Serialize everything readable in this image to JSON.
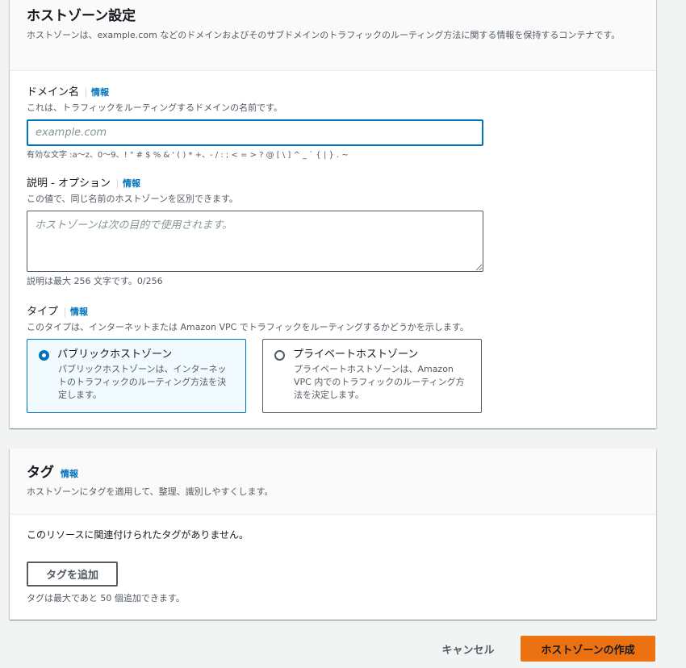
{
  "colors": {
    "accent": "#0073bb",
    "primary_button": "#ec7211",
    "page_background": "#f2f3f3",
    "selected_tile": "#f1faff"
  },
  "hosted_zone": {
    "title": "ホストゾーン設定",
    "description": "ホストゾーンは、example.com などのドメインおよびそのサブドメインのトラフィックのルーティング方法に関する情報を保持するコンテナです。"
  },
  "domain": {
    "label": "ドメイン名",
    "info": "情報",
    "description": "これは、トラフィックをルーティングするドメインの名前です。",
    "value": "",
    "placeholder": "example.com",
    "constraint": "有効な文字 :a〜z、0〜9、! \" # $ % & ' ( ) * +、- / : ; < = > ? @ [ \\ ] ^ _ ` { | } . ~"
  },
  "comment": {
    "label": "説明 - オプション",
    "info": "情報",
    "description": "この値で、同じ名前のホストゾーンを区別できます。",
    "value": "",
    "placeholder": "ホストゾーンは次の目的で使用されます。",
    "constraint": "説明は最大 256 文字です。0/256"
  },
  "type": {
    "label": "タイプ",
    "info": "情報",
    "description": "このタイプは、インターネットまたは Amazon VPC でトラフィックをルーティングするかどうかを示します。",
    "options": [
      {
        "title": "パブリックホストゾーン",
        "description": "パブリックホストゾーンは、インターネットのトラフィックのルーティング方法を決定します。",
        "selected": true
      },
      {
        "title": "プライベートホストゾーン",
        "description": "プライベートホストゾーンは、Amazon VPC 内でのトラフィックのルーティング方法を決定します。",
        "selected": false
      }
    ]
  },
  "tags": {
    "title": "タグ",
    "info": "情報",
    "description": "ホストゾーンにタグを適用して、整理、識別しやすくします。",
    "empty_message": "このリソースに関連付けられたタグがありません。",
    "add_button": "タグを追加",
    "limit_text": "タグは最大であと 50 個追加できます。"
  },
  "footer": {
    "cancel": "キャンセル",
    "create": "ホストゾーンの作成"
  }
}
